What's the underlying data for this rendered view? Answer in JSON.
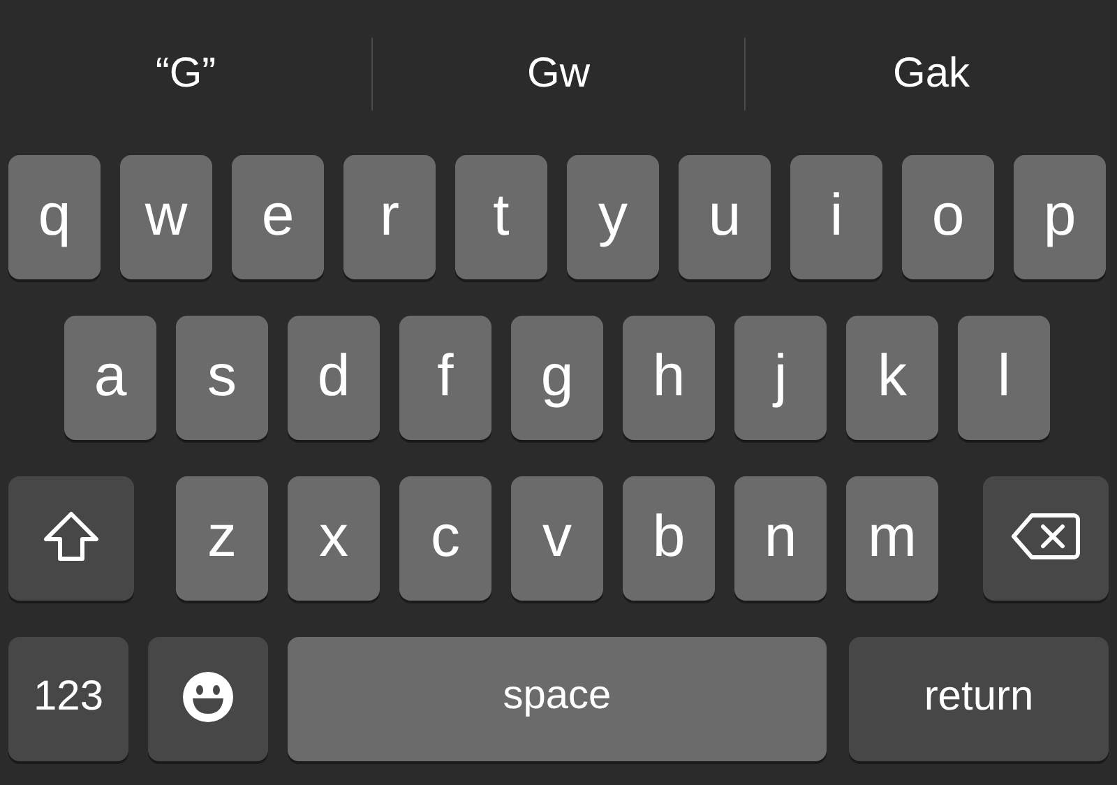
{
  "suggestions": [
    {
      "text": "“G”"
    },
    {
      "text": "Gw"
    },
    {
      "text": "Gak"
    }
  ],
  "rows": [
    {
      "keys": [
        {
          "kind": "letter",
          "label": "q"
        },
        {
          "kind": "letter",
          "label": "w"
        },
        {
          "kind": "letter",
          "label": "e"
        },
        {
          "kind": "letter",
          "label": "r"
        },
        {
          "kind": "letter",
          "label": "t"
        },
        {
          "kind": "letter",
          "label": "y"
        },
        {
          "kind": "letter",
          "label": "u"
        },
        {
          "kind": "letter",
          "label": "i"
        },
        {
          "kind": "letter",
          "label": "o"
        },
        {
          "kind": "letter",
          "label": "p"
        }
      ]
    },
    {
      "keys": [
        {
          "kind": "letter",
          "label": "a"
        },
        {
          "kind": "letter",
          "label": "s"
        },
        {
          "kind": "letter",
          "label": "d"
        },
        {
          "kind": "letter",
          "label": "f"
        },
        {
          "kind": "letter",
          "label": "g"
        },
        {
          "kind": "letter",
          "label": "h"
        },
        {
          "kind": "letter",
          "label": "j"
        },
        {
          "kind": "letter",
          "label": "k"
        },
        {
          "kind": "letter",
          "label": "l"
        }
      ]
    },
    {
      "keys": [
        {
          "kind": "shift"
        },
        {
          "kind": "letter",
          "label": "z"
        },
        {
          "kind": "letter",
          "label": "x"
        },
        {
          "kind": "letter",
          "label": "c"
        },
        {
          "kind": "letter",
          "label": "v"
        },
        {
          "kind": "letter",
          "label": "b"
        },
        {
          "kind": "letter",
          "label": "n"
        },
        {
          "kind": "letter",
          "label": "m"
        },
        {
          "kind": "delete"
        }
      ]
    },
    {
      "keys": [
        {
          "kind": "numbers",
          "label": "123"
        },
        {
          "kind": "emoji"
        },
        {
          "kind": "space",
          "label": "space"
        },
        {
          "kind": "return",
          "label": "return"
        }
      ]
    }
  ]
}
